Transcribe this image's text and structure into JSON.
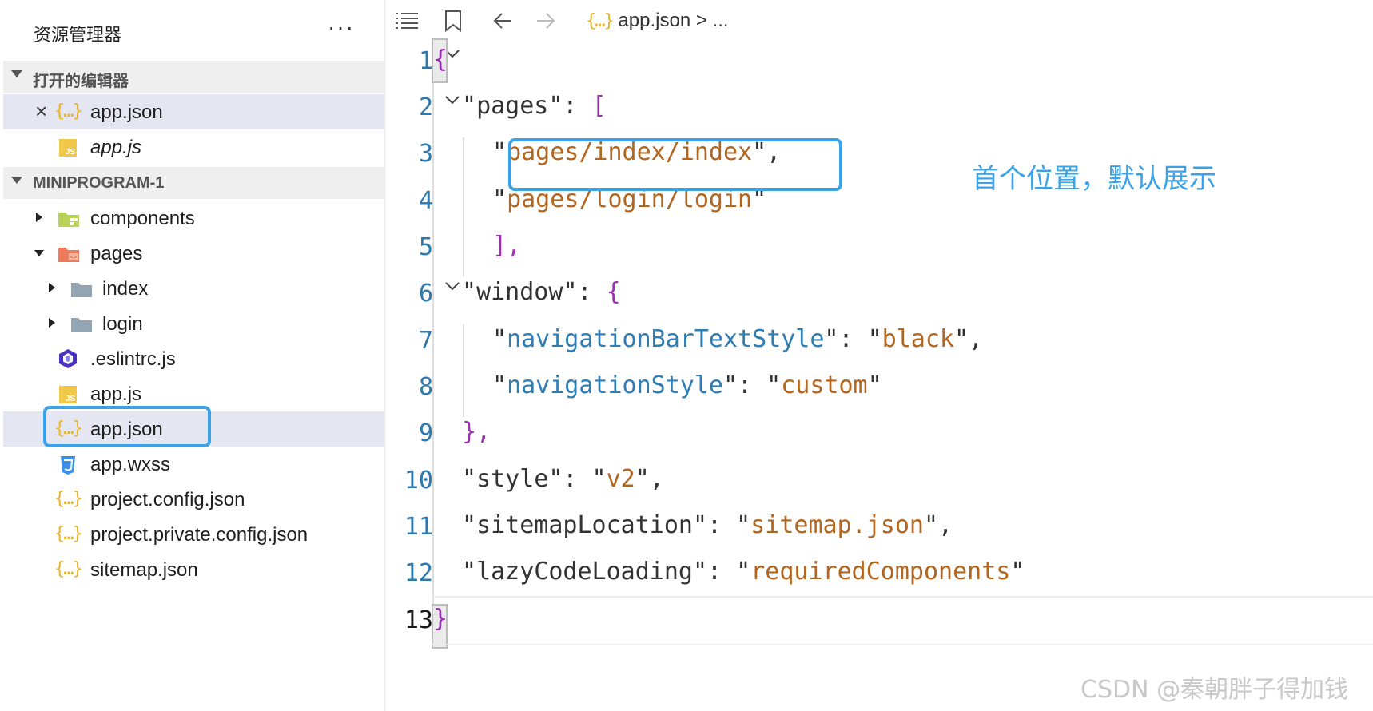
{
  "sidebar": {
    "title": "资源管理器",
    "more": "···",
    "open_editors": {
      "label": "打开的编辑器",
      "items": [
        {
          "label": "app.json",
          "icon": "json-icon"
        },
        {
          "label": "app.js",
          "icon": "js-icon"
        }
      ]
    },
    "project": {
      "label": "MINIPROGRAM-1",
      "items": [
        {
          "label": "components",
          "icon": "folder-components-icon"
        },
        {
          "label": "pages",
          "icon": "folder-pages-icon"
        },
        {
          "label": "index",
          "icon": "folder-icon"
        },
        {
          "label": "login",
          "icon": "folder-icon"
        },
        {
          "label": ".eslintrc.js",
          "icon": "eslint-icon"
        },
        {
          "label": "app.js",
          "icon": "js-icon"
        },
        {
          "label": "app.json",
          "icon": "json-icon"
        },
        {
          "label": "app.wxss",
          "icon": "css-icon"
        },
        {
          "label": "project.config.json",
          "icon": "json-icon"
        },
        {
          "label": "project.private.config.json",
          "icon": "json-icon"
        },
        {
          "label": "sitemap.json",
          "icon": "json-icon"
        }
      ]
    }
  },
  "toolbar": {
    "breadcrumb_file": "app.json",
    "breadcrumb_sep": ">",
    "breadcrumb_more": "..."
  },
  "editor": {
    "line_numbers": [
      "1",
      "2",
      "3",
      "4",
      "5",
      "6",
      "7",
      "8",
      "9",
      "10",
      "11",
      "12",
      "13"
    ],
    "lines": {
      "l1": {
        "open": "{"
      },
      "l2": {
        "key": "pages",
        "open": "["
      },
      "l3": {
        "value": "pages/index/index"
      },
      "l4": {
        "value": "pages/login/login"
      },
      "l5": {
        "close": "],"
      },
      "l6": {
        "key": "window",
        "open": "{"
      },
      "l7": {
        "key": "navigationBarTextStyle",
        "value": "black"
      },
      "l8": {
        "key": "navigationStyle",
        "value": "custom"
      },
      "l9": {
        "close": "},"
      },
      "l10": {
        "key": "style",
        "value": "v2"
      },
      "l11": {
        "key": "sitemapLocation",
        "value": "sitemap.json"
      },
      "l12": {
        "key": "lazyCodeLoading",
        "value": "requiredComponents"
      },
      "l13": {
        "close": "}"
      }
    }
  },
  "annotation": "首个位置，默认展示",
  "watermark": "CSDN @秦朝胖子得加钱",
  "colors": {
    "highlight": "#3aa3e8",
    "json_key": "#2e7db4",
    "json_string": "#b2651f",
    "json_bracket": "#9a2fb0"
  }
}
